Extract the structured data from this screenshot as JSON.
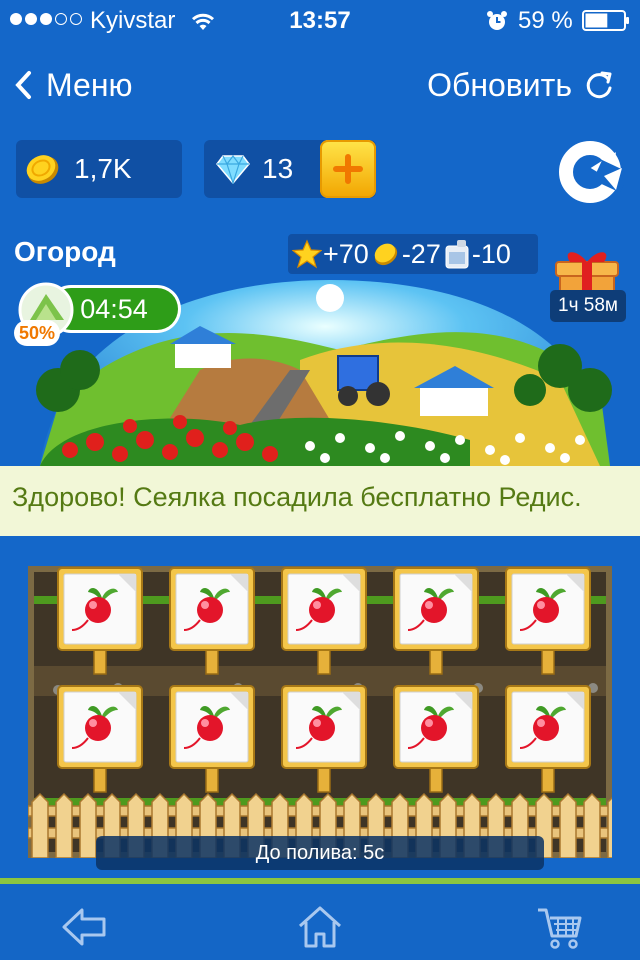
{
  "status_bar": {
    "carrier": "Kyivstar",
    "time": "13:57",
    "battery_percent": "59 %",
    "signal_bars_filled": 3,
    "signal_bars_total": 5,
    "battery_level": 0.59
  },
  "nav": {
    "back_label": "Меню",
    "refresh_label": "Обновить"
  },
  "resources": {
    "coins": "1,7K",
    "gems": "13"
  },
  "field": {
    "title": "Огород",
    "rewards": {
      "xp": "+70",
      "coins": "-27",
      "water": "-10"
    },
    "gift_timer": "1ч 58м",
    "grow_timer": "04:54",
    "growth_percent": "50%"
  },
  "message": "Здорово! Сеялка посадила бесплатно Редис.",
  "plot": {
    "crop_icon": "radish-icon",
    "rows": 2,
    "columns": 5,
    "water_label": "До полива:",
    "water_value": "5с"
  },
  "tab_bar": {
    "icons": [
      "back-arrow-icon",
      "home-icon",
      "cart-icon"
    ]
  },
  "colors": {
    "background": "#1467c9",
    "panel": "#1050a4",
    "accent_green": "#8cc63f",
    "message_text": "#557a13",
    "message_bg": "#f2f7d7",
    "timer_green": "#2e9d18",
    "gold": "#f5b800"
  }
}
